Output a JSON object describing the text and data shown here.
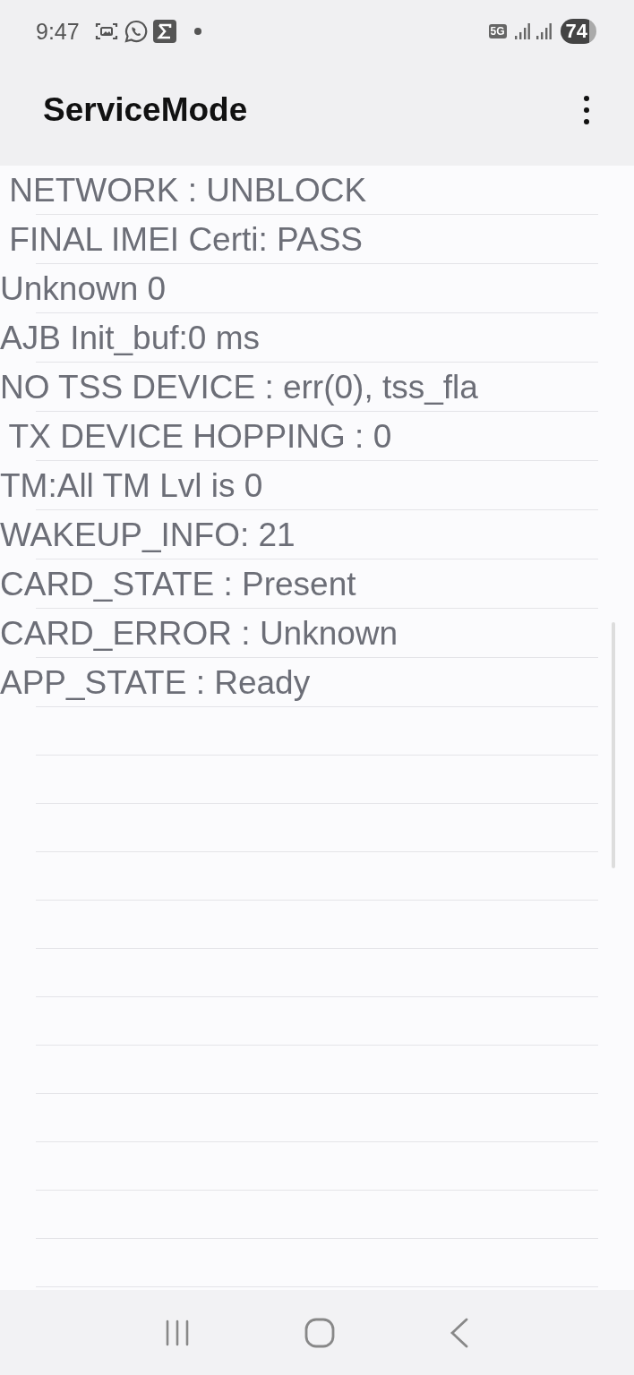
{
  "status_bar": {
    "time": "9:47",
    "network": "5G",
    "battery": "74"
  },
  "app_bar": {
    "title": "ServiceMode"
  },
  "lines": [
    " NETWORK : UNBLOCK",
    " FINAL IMEI Certi: PASS",
    "Unknown 0",
    "AJB Init_buf:0 ms",
    "NO TSS DEVICE : err(0), tss_fla",
    " TX DEVICE HOPPING : 0",
    "TM:All TM Lvl is 0",
    "WAKEUP_INFO: 21",
    "CARD_STATE : Present",
    "CARD_ERROR : Unknown",
    "APP_STATE : Ready"
  ]
}
